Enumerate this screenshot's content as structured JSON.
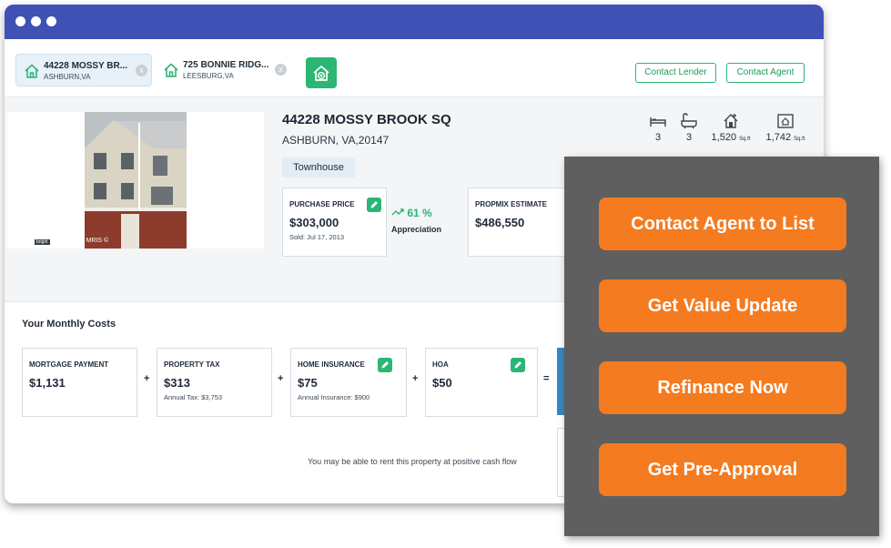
{
  "tabs": [
    {
      "title": "44228 MOSSY BR...",
      "subtitle": "ASHBURN,VA"
    },
    {
      "title": "725 BONNIE RIDG...",
      "subtitle": "LEESBURG,VA"
    }
  ],
  "tab_close_glyph": "x",
  "header_buttons": {
    "lender": "Contact Lender",
    "agent": "Contact Agent"
  },
  "property": {
    "address": "44228 MOSSY BROOK SQ",
    "city": "ASHBURN, VA,20147",
    "type": "Townhouse",
    "photo_caption": "©Copyright 2006 MRIS ©",
    "photo_brand": "bright"
  },
  "features": [
    {
      "icon": "bed-icon",
      "value": "3",
      "unit": ""
    },
    {
      "icon": "bath-icon",
      "value": "3",
      "unit": ""
    },
    {
      "icon": "house-size-icon",
      "value": "1,520",
      "unit": "Sq.ft"
    },
    {
      "icon": "lot-size-icon",
      "value": "1,742",
      "unit": "Sq.ft"
    }
  ],
  "purchase": {
    "label": "PURCHASE PRICE",
    "value": "$303,000",
    "sold": "Sold: Jul 17, 2013"
  },
  "appreciation": {
    "value": "61 %",
    "label": "Appreciation"
  },
  "estimate": {
    "label": "PROPMIX ESTIMATE",
    "value": "$486,550"
  },
  "monthly": {
    "title": "Your Monthly Costs",
    "items": [
      {
        "label": "MORTGAGE PAYMENT",
        "value": "$1,131",
        "sub": ""
      },
      {
        "label": "PROPERTY TAX",
        "value": "$313",
        "sub": "Annual Tax: $3,753"
      },
      {
        "label": "HOME INSURANCE",
        "value": "$75",
        "sub": "Annual Insurance: $900"
      },
      {
        "label": "HOA",
        "value": "$50",
        "sub": ""
      }
    ],
    "operators": [
      "+",
      "+",
      "+",
      "="
    ],
    "cashflow_note": "You may be able to rent this property at positive cash flow"
  },
  "cta_buttons": [
    "Contact Agent to List",
    "Get Value Update",
    "Refinance Now",
    "Get Pre-Approval"
  ],
  "colors": {
    "titlebar": "#3f51b5",
    "accent_green": "#2bb673",
    "cta_orange": "#f47b20",
    "panel": "#5f5f5f"
  }
}
